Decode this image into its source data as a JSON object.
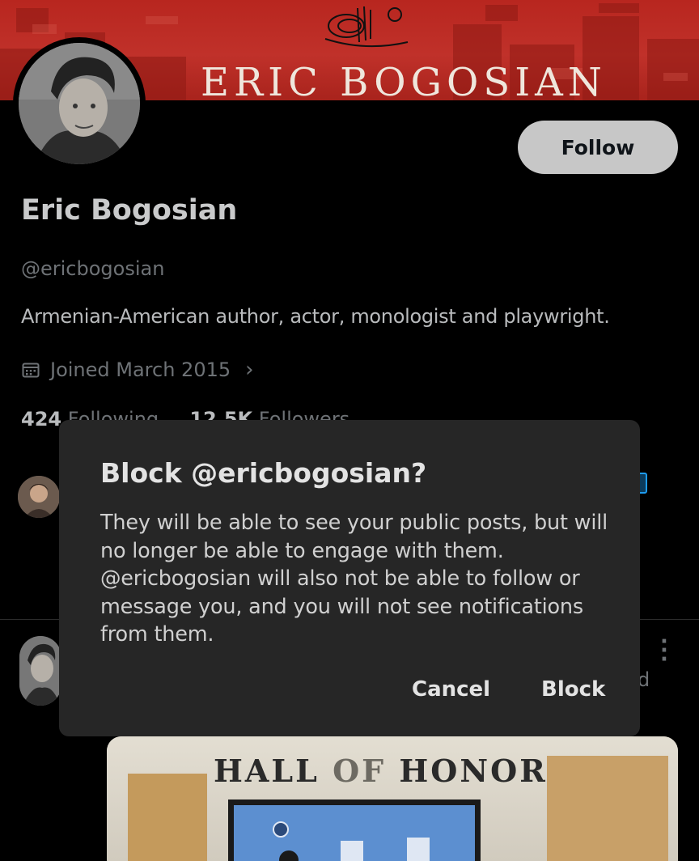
{
  "banner": {
    "title": "ERIC BOGOSIAN"
  },
  "profile": {
    "name": "Eric Bogosian",
    "handle": "@ericbogosian",
    "bio": "Armenian-American author, actor, monologist and playwright.",
    "joined": "Joined March 2015",
    "following_count": "424",
    "following_label": "Following",
    "followers_count": "12.5K",
    "followers_label": "Followers",
    "follow_label": "Follow"
  },
  "dialog": {
    "title": "Block @ericbogosian?",
    "body": "They will be able to see your public posts, but will no longer be able to engage with them. @ericbogosian will also not be able to follow or message you, and you will not see notifications from them.",
    "cancel_label": "Cancel",
    "block_label": "Block"
  },
  "tweet": {
    "partial_text": "d",
    "media_text": {
      "hall": "HALL",
      "of": "OF",
      "honor": "HONOR"
    }
  },
  "colors": {
    "background": "#000000",
    "banner": "#b8261f",
    "dialog": "#262626",
    "follow_button": "#c7c7c7"
  }
}
